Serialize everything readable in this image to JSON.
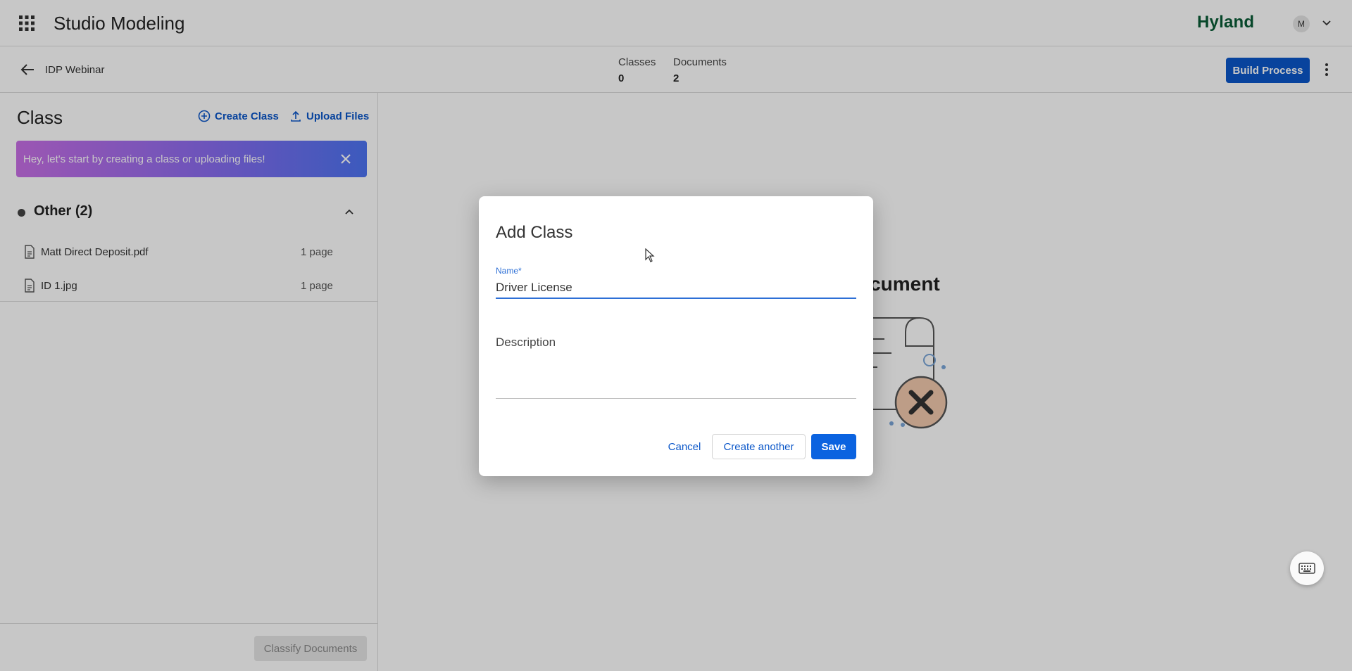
{
  "header": {
    "app_title": "Studio Modeling",
    "brand": "Hyland",
    "avatar_initial": "M",
    "icons": {
      "apps": "apps-grid-icon",
      "caret": "chevron-down-icon"
    }
  },
  "subheader": {
    "project_name": "IDP Webinar",
    "stats": [
      {
        "label": "Classes",
        "value": "0"
      },
      {
        "label": "Documents",
        "value": "2"
      }
    ],
    "build_button": "Build Process"
  },
  "left_panel": {
    "title": "Class",
    "create_class": "Create Class",
    "upload_files": "Upload Files",
    "banner": "Hey, let's start by creating a class or uploading files!",
    "group": {
      "label": "Other (2)",
      "files": [
        {
          "name": "Matt Direct Deposit.pdf",
          "pages": "1 page"
        },
        {
          "name": "ID 1.jpg",
          "pages": "1 page"
        }
      ]
    },
    "classify_button": "Classify Documents"
  },
  "main": {
    "empty_title_partial": "ocument"
  },
  "dialog": {
    "title": "Add Class",
    "name_label": "Name*",
    "name_value": "Driver License",
    "description_label": "Description",
    "description_value": "",
    "cancel": "Cancel",
    "create_another": "Create another",
    "save": "Save"
  },
  "colors": {
    "primary": "#0b57c9",
    "brand_green": "#0a5c36",
    "banner_start": "#c86fe6",
    "banner_end": "#4d74f2",
    "input_focus": "#2d6fd6"
  }
}
